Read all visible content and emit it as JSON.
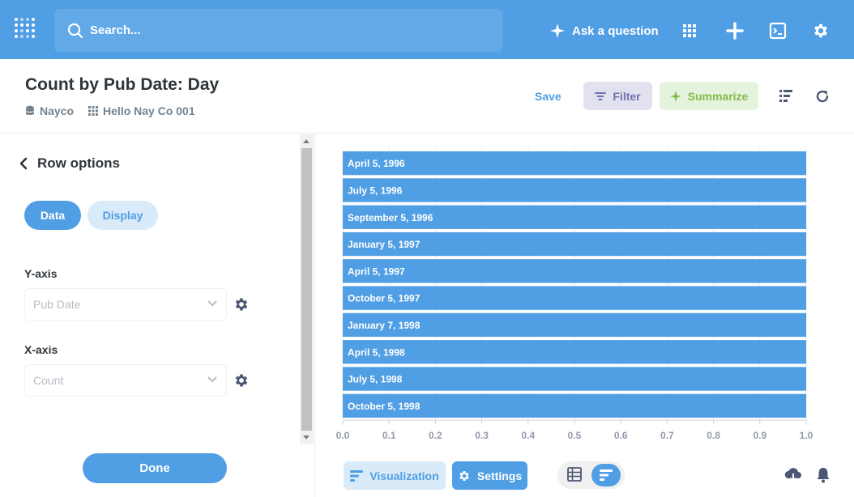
{
  "nav": {
    "search_placeholder": "Search...",
    "ask_label": "Ask a question"
  },
  "header": {
    "title": "Count by Pub Date: Day",
    "breadcrumbs": [
      "Nayco",
      "Hello Nay Co 001"
    ],
    "save_label": "Save",
    "filter_label": "Filter",
    "summarize_label": "Summarize"
  },
  "sidebar": {
    "back_label": "Row options",
    "tabs": [
      "Data",
      "Display"
    ],
    "active_tab": "Data",
    "yaxis_label": "Y-axis",
    "yaxis_value": "Pub Date",
    "xaxis_label": "X-axis",
    "xaxis_value": "Count",
    "done_label": "Done"
  },
  "footer": {
    "visualization_label": "Visualization",
    "settings_label": "Settings"
  },
  "colors": {
    "brand": "#509ee3",
    "filter": "#7172ad",
    "summarize": "#84bb4c"
  },
  "chart_data": {
    "type": "bar",
    "orientation": "horizontal",
    "categories": [
      "April 5, 1996",
      "July 5, 1996",
      "September 5, 1996",
      "January 5, 1997",
      "April 5, 1997",
      "October 5, 1997",
      "January 7, 1998",
      "April 5, 1998",
      "July 5, 1998",
      "October 5, 1998"
    ],
    "values": [
      1,
      1,
      1,
      1,
      1,
      1,
      1,
      1,
      1,
      1
    ],
    "xlim": [
      0,
      1.0
    ],
    "xticks": [
      "0.0",
      "0.1",
      "0.2",
      "0.3",
      "0.4",
      "0.5",
      "0.6",
      "0.7",
      "0.8",
      "0.9",
      "1.0"
    ],
    "grid": true,
    "color": "#509ee3"
  }
}
